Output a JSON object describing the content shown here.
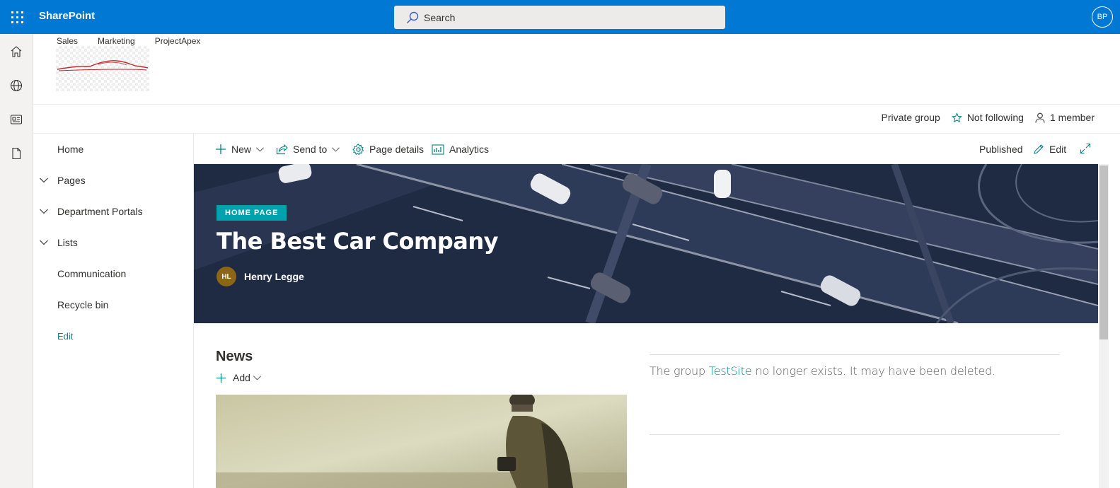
{
  "suitebar": {
    "brand": "SharePoint",
    "search_placeholder": "Search",
    "user_initials": "BP",
    "background": "#0078d4"
  },
  "appbar": {
    "items": [
      "home-icon",
      "globe-icon",
      "news-icon",
      "document-icon"
    ]
  },
  "site": {
    "hub_nav": [
      "Sales",
      "Marketing",
      "ProjectApex"
    ],
    "info": {
      "privacy": "Private group",
      "follow": "Not following",
      "members": "1 member"
    }
  },
  "leftnav": {
    "items": [
      {
        "label": "Home",
        "expandable": false
      },
      {
        "label": "Pages",
        "expandable": true
      },
      {
        "label": "Department Portals",
        "expandable": true
      },
      {
        "label": "Lists",
        "expandable": true
      },
      {
        "label": "Communication",
        "expandable": false
      },
      {
        "label": "Recycle bin",
        "expandable": false
      }
    ],
    "edit_label": "Edit"
  },
  "commandbar": {
    "new": "New",
    "send_to": "Send to",
    "page_details": "Page details",
    "analytics": "Analytics",
    "status": "Published",
    "edit": "Edit"
  },
  "hero": {
    "tag": "HOME PAGE",
    "title": "The Best Car Company",
    "author_initials": "HL",
    "author_name": "Henry Legge"
  },
  "news": {
    "title": "News",
    "add_label": "Add"
  },
  "group_message": {
    "before": "The group ",
    "link": "TestSite",
    "after": " no longer exists. It may have been deleted."
  },
  "colors": {
    "accent": "#038387",
    "tag": "#00a2ad"
  }
}
